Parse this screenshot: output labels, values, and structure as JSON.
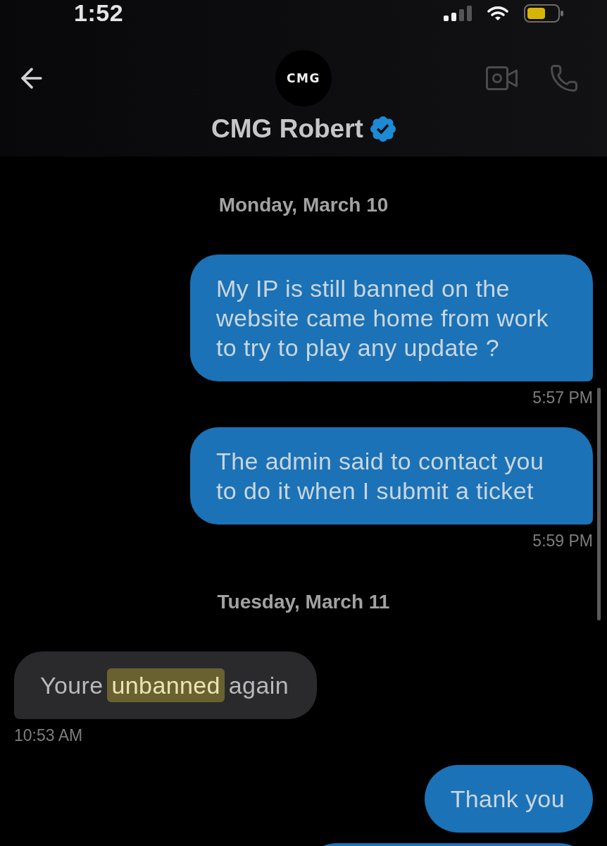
{
  "status_bar": {
    "time": "1:52"
  },
  "header": {
    "avatar_text": "CMG",
    "name": "CMG Robert",
    "verified": true
  },
  "thread": [
    {
      "kind": "date",
      "label": "Monday, March 10"
    },
    {
      "kind": "sent",
      "text": "My IP is still banned on the website came home from work to try to play any update ?",
      "time": "5:57 PM"
    },
    {
      "kind": "sent",
      "text": "The admin said to contact you to do it when I submit a ticket",
      "time": "5:59 PM"
    },
    {
      "kind": "date",
      "label": "Tuesday, March 11"
    },
    {
      "kind": "received",
      "segments": [
        {
          "text": "Youre ",
          "highlighted": false
        },
        {
          "text": "unbanned",
          "highlighted": true
        },
        {
          "text": " again",
          "highlighted": false
        }
      ],
      "time": "10:53 AM"
    },
    {
      "kind": "sent",
      "text": "Thank you"
    },
    {
      "kind": "sent"
    }
  ]
}
